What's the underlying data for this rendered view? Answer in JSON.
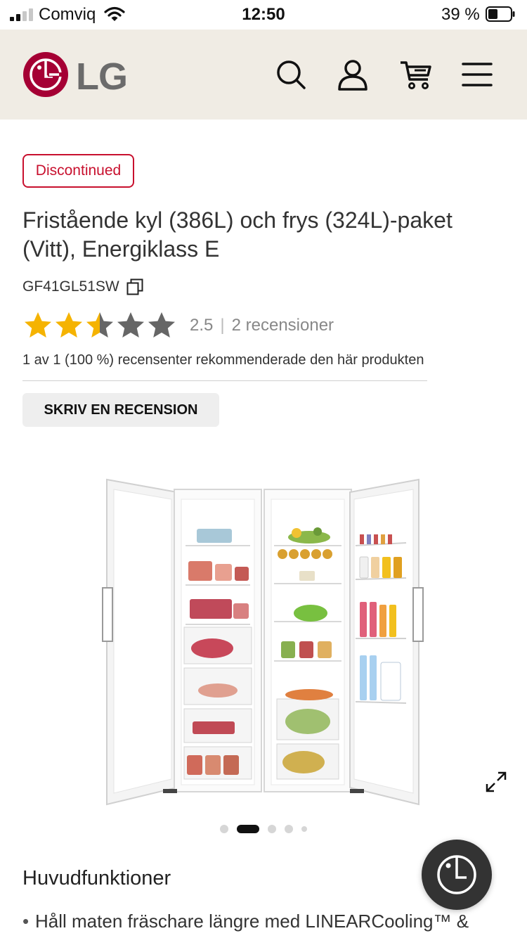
{
  "status_bar": {
    "carrier": "Comviq",
    "time": "12:50",
    "battery": "39 %"
  },
  "header": {
    "brand": "LG",
    "icons": [
      "search-icon",
      "user-icon",
      "cart-icon",
      "menu-icon"
    ],
    "brand_color": "#a50034",
    "background_color": "#f0ece4"
  },
  "product": {
    "badge": "Discontinued",
    "badge_color": "#c8102e",
    "title": "Fristående kyl (386L) och frys (324L)-paket (Vitt), Energiklass E",
    "sku": "GF41GL51SW",
    "rating": {
      "value": "2.5",
      "stars_out_of": 5,
      "filled_fraction": 0.5,
      "separator": "|",
      "review_count": "2 recensioner",
      "star_color": "#f5b301"
    },
    "recommend_text": "1 av 1 (100 %) recensenter rekommenderade den här produkten",
    "write_review_label": "SKRIV EN RECENSION"
  },
  "gallery": {
    "slide_count": 5,
    "active_index": 1
  },
  "features": {
    "heading": "Huvudfunktioner",
    "items": [
      "Håll maten fräschare längre med LINEARCooling™ &"
    ]
  }
}
